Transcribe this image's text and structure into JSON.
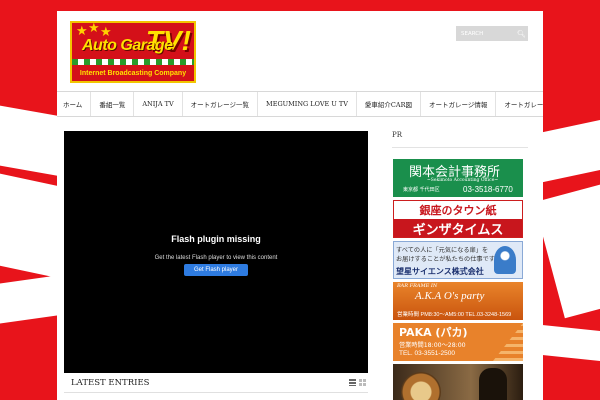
{
  "header": {
    "logo": {
      "title": "Auto Garage",
      "big": "TV!",
      "subtitle": "Internet Broadcasting Company"
    },
    "search": {
      "placeholder": "SEARCH",
      "icon": "search-icon"
    }
  },
  "nav": {
    "items": [
      {
        "label": "ホーム"
      },
      {
        "label": "番組一覧"
      },
      {
        "label": "ANIJA TV"
      },
      {
        "label": "オートガレージ一覧"
      },
      {
        "label": "MEGUMING LOVE U TV"
      },
      {
        "label": "愛車紹介CAR図"
      },
      {
        "label": "オートガレージ情報"
      },
      {
        "label": "オートガレージ公式TV"
      }
    ]
  },
  "player": {
    "title": "Flash plugin missing",
    "subtitle": "Get the latest Flash player to view this content",
    "button": "Get Flash player"
  },
  "latest": {
    "title": "LATEST ENTRIES",
    "icons": [
      "list-view-icon",
      "grid-view-icon"
    ]
  },
  "sidebar": {
    "label": "PR",
    "ads": {
      "ad1": {
        "main": "関本会計事務所",
        "sub": "~Sekimoto Accounting Office~",
        "location": "東京都 千代田区",
        "tel": "03-3518-6770"
      },
      "ad2": {
        "top": "銀座のタウン紙",
        "bottom": "ギンザタイムス"
      },
      "ad3": {
        "line1": "すべての人に「元気になる扉」を",
        "line2": "お届けすることが私たちの仕事です",
        "company": "望星サイエンス株式会社"
      },
      "ad4": {
        "frame": "BAR FRAME IN",
        "name": "A.K.A O's party",
        "hours": "営業時間 PM8:30～AM5:00  TEL.03-3248-1569"
      },
      "ad5": {
        "name": "PAKA (パカ)",
        "hours": "営業時間18:00～28:00",
        "tel": "TEL. 03-3551-2500"
      }
    }
  },
  "colors": {
    "background_red": "#e8141b",
    "logo_yellow": "#ffe100",
    "flash_button_blue": "#2e7be0"
  }
}
